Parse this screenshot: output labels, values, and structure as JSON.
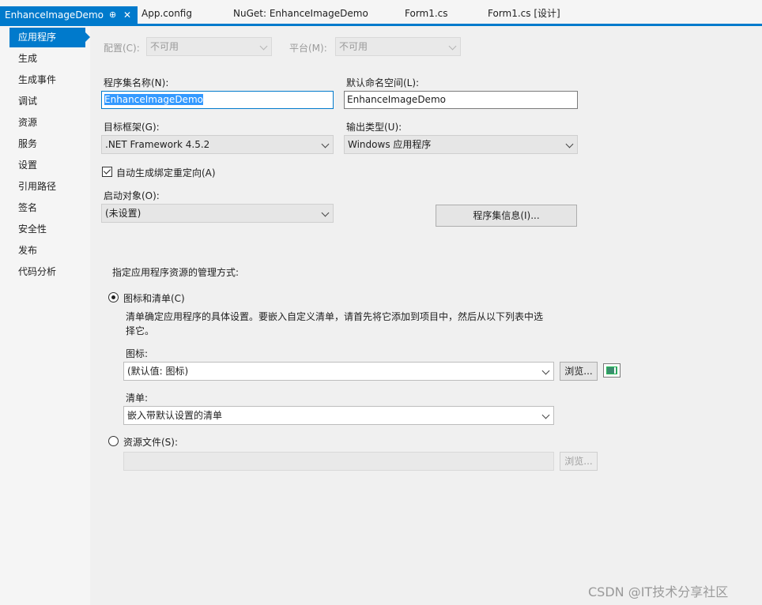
{
  "tabs": [
    {
      "label": "EnhanceImageDemo",
      "active": true
    },
    {
      "label": "App.config"
    },
    {
      "label": "NuGet: EnhanceImageDemo"
    },
    {
      "label": "Form1.cs"
    },
    {
      "label": "Form1.cs [设计]"
    }
  ],
  "tab_icons": {
    "pin": "⊕",
    "close": "✕"
  },
  "sidebar": {
    "items": [
      {
        "label": "应用程序",
        "active": true
      },
      {
        "label": "生成"
      },
      {
        "label": "生成事件"
      },
      {
        "label": "调试"
      },
      {
        "label": "资源"
      },
      {
        "label": "服务"
      },
      {
        "label": "设置"
      },
      {
        "label": "引用路径"
      },
      {
        "label": "签名"
      },
      {
        "label": "安全性"
      },
      {
        "label": "发布"
      },
      {
        "label": "代码分析"
      }
    ]
  },
  "config": {
    "config_label": "配置(C):",
    "config_value": "不可用",
    "platform_label": "平台(M):",
    "platform_value": "不可用"
  },
  "assembly": {
    "name_label": "程序集名称(N):",
    "name_value": "EnhanceImageDemo",
    "namespace_label": "默认命名空间(L):",
    "namespace_value": "EnhanceImageDemo",
    "framework_label": "目标框架(G):",
    "framework_value": ".NET Framework 4.5.2",
    "output_label": "输出类型(U):",
    "output_value": "Windows 应用程序",
    "autobind_label": "自动生成绑定重定向(A)",
    "autobind_checked": true,
    "startup_label": "启动对象(O):",
    "startup_value": "(未设置)",
    "assembly_info_button": "程序集信息(I)..."
  },
  "resources": {
    "heading": "指定应用程序资源的管理方式:",
    "icon_manifest_radio": "图标和清单(C)",
    "icon_manifest_selected": true,
    "description_line1": "清单确定应用程序的具体设置。要嵌入自定义清单，请首先将它添加到项目中，然后从以下列表中选",
    "description_line2": "择它。",
    "icon_label": "图标:",
    "icon_value": "(默认值: 图标)",
    "browse_label": "浏览...",
    "manifest_label": "清单:",
    "manifest_value": "嵌入带默认设置的清单",
    "resource_file_radio": "资源文件(S):",
    "resource_file_value": "",
    "browse2_label": "浏览..."
  },
  "watermark": "CSDN @IT技术分享社区",
  "colors": {
    "accent": "#007acc",
    "selection": "#3399ff"
  }
}
